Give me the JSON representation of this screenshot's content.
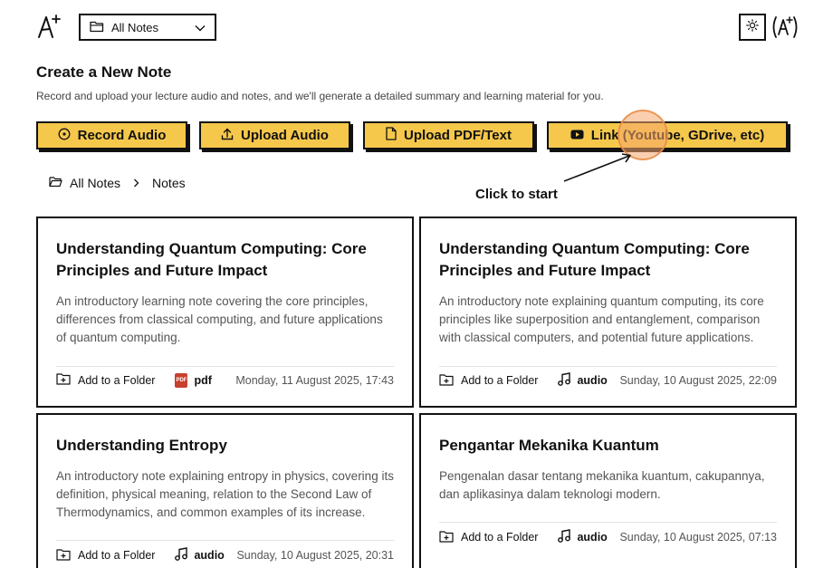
{
  "header": {
    "logo_text": "A+",
    "folder_select_value": "All Notes",
    "avatar_text": "(A+)"
  },
  "intro": {
    "title": "Create a New Note",
    "subtitle": "Record and upload your lecture audio and notes, and we'll generate a detailed summary and learning material for you."
  },
  "actions": {
    "record": "Record Audio",
    "upload": "Upload Audio",
    "pdf": "Upload PDF/Text",
    "link": "Link (Youtube, GDrive, etc)",
    "hint": "Click to start"
  },
  "breadcrumb": {
    "root": "All Notes",
    "current": "Notes"
  },
  "notes": [
    {
      "title": "Understanding Quantum Computing: Core Principles and Future Impact",
      "description": "An introductory learning note covering the core principles, differences from classical computing, and future applications of quantum computing.",
      "add_folder": "Add to a Folder",
      "type": "pdf",
      "type_icon": "pdf-icon",
      "date": "Monday, 11 August 2025, 17:43"
    },
    {
      "title": "Understanding Quantum Computing: Core Principles and Future Impact",
      "description": "An introductory note explaining quantum computing, its core principles like superposition and entanglement, comparison with classical computers, and potential future applications.",
      "add_folder": "Add to a Folder",
      "type": "audio",
      "type_icon": "music-note-icon",
      "date": "Sunday, 10 August 2025, 22:09"
    },
    {
      "title": "Understanding Entropy",
      "description": "An introductory note explaining entropy in physics, covering its definition, physical meaning, relation to the Second Law of Thermodynamics, and common examples of its increase.",
      "add_folder": "Add to a Folder",
      "type": "audio",
      "type_icon": "music-note-icon",
      "date": "Sunday, 10 August 2025, 20:31"
    },
    {
      "title": "Pengantar Mekanika Kuantum",
      "description": "Pengenalan dasar tentang mekanika kuantum, cakupannya, dan aplikasinya dalam teknologi modern.",
      "add_folder": "Add to a Folder",
      "type": "audio",
      "type_icon": "music-note-icon",
      "date": "Sunday, 10 August 2025, 07:13"
    }
  ],
  "colors": {
    "accent": "#f5c84c",
    "border": "#111111",
    "highlight": "#f5a86e"
  }
}
